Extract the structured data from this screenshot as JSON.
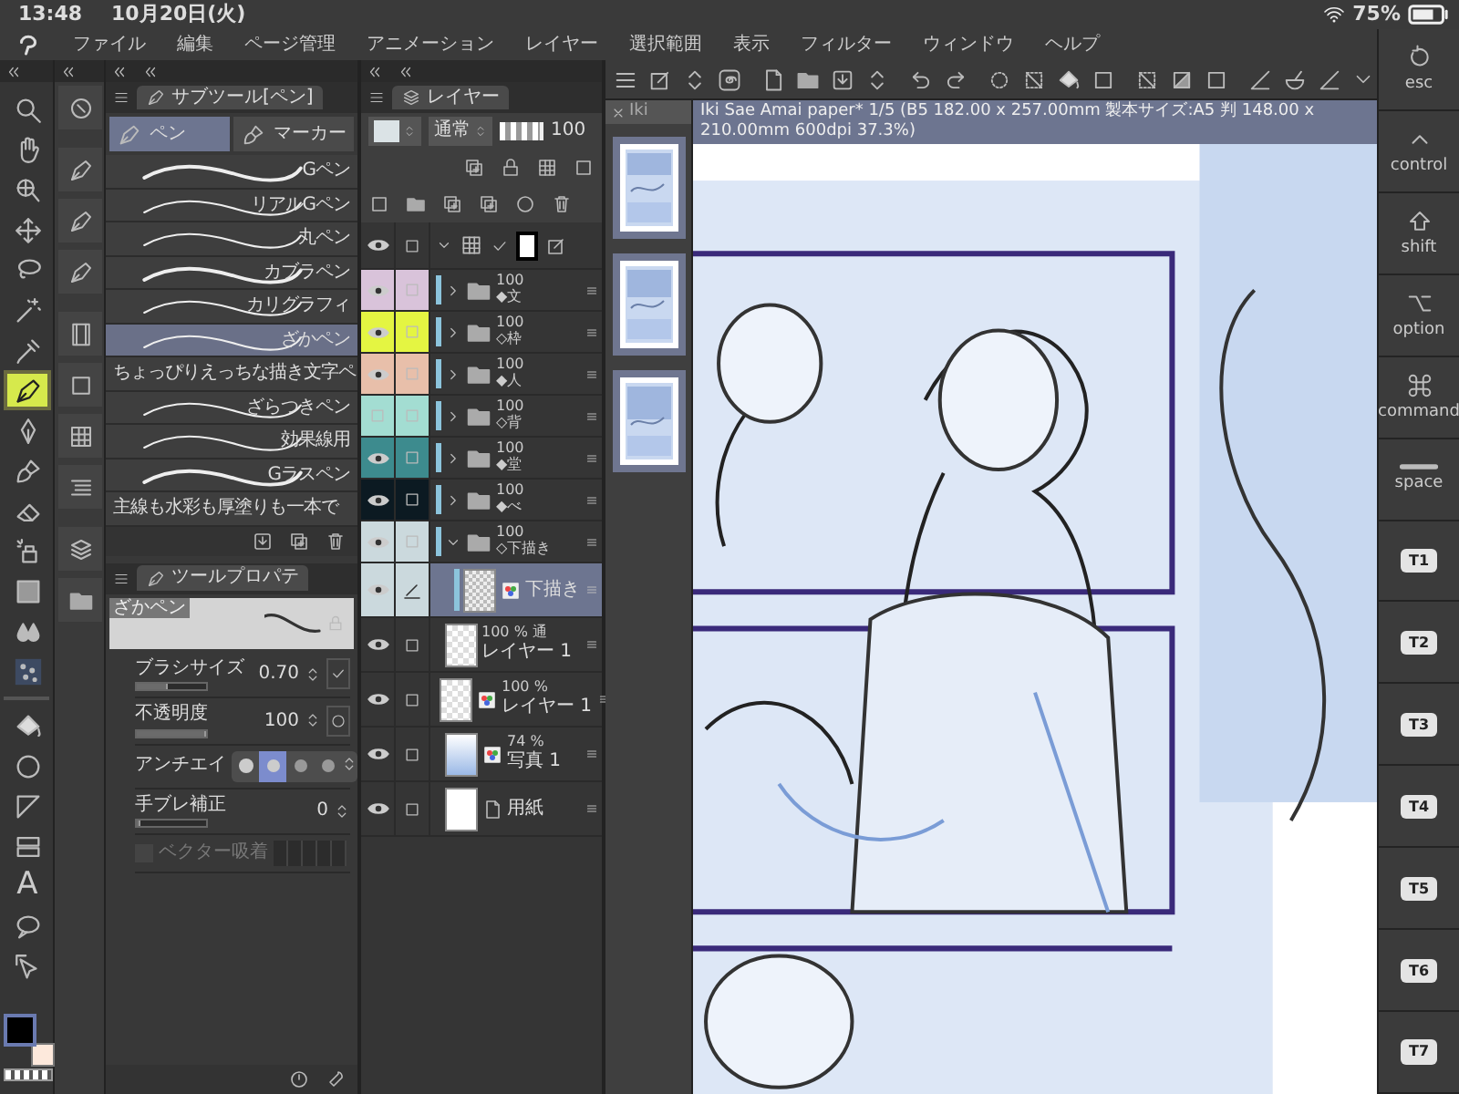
{
  "status_bar": {
    "time": "13:48",
    "date": "10月20日(火)",
    "battery": "75%"
  },
  "menu": [
    "ファイル",
    "編集",
    "ページ管理",
    "アニメーション",
    "レイヤー",
    "選択範囲",
    "表示",
    "フィルター",
    "ウィンドウ",
    "ヘルプ"
  ],
  "tools": [
    {
      "selected": false
    },
    {
      "selected": false
    },
    {
      "selected": false
    },
    {
      "selected": false
    },
    {
      "selected": false
    },
    {
      "selected": false
    },
    {
      "selected": false
    },
    {
      "selected": true
    },
    {
      "selected": false
    },
    {
      "selected": false
    },
    {
      "selected": false
    },
    {
      "selected": false
    },
    {
      "selected": false
    },
    {
      "selected": false
    },
    {
      "selected": false
    },
    {
      "selected": false
    },
    {
      "selected": false
    },
    {
      "selected": false
    },
    {
      "selected": false
    },
    {
      "selected": false,
      "glyph": "A"
    },
    {
      "selected": false
    },
    {
      "selected": false
    }
  ],
  "subtool_panel": {
    "title": "サブツール[ペン]",
    "tabs": [
      {
        "label": "ペン",
        "selected": true
      },
      {
        "label": "マーカー",
        "selected": false
      }
    ],
    "brushes": [
      {
        "kind": "stroke",
        "label": "Gペン",
        "selected": false
      },
      {
        "kind": "stroke",
        "label": "リアルGペン",
        "selected": false
      },
      {
        "kind": "stroke",
        "label": "丸ペン",
        "selected": false
      },
      {
        "kind": "stroke",
        "label": "カブラペン",
        "selected": false
      },
      {
        "kind": "stroke",
        "label": "カリグラフィ",
        "selected": false
      },
      {
        "kind": "stroke",
        "label": "ざかペン",
        "selected": true
      },
      {
        "kind": "text",
        "label": "ちょっぴりえっちな描き文字ペ",
        "selected": false
      },
      {
        "kind": "stroke",
        "label": "ざらつきペン",
        "selected": false
      },
      {
        "kind": "stroke",
        "label": "効果線用",
        "selected": false
      },
      {
        "kind": "stroke",
        "label": "Gラスペン",
        "selected": false
      },
      {
        "kind": "text",
        "label": "主線も水彩も厚塗りも一本で",
        "selected": false
      }
    ]
  },
  "tool_property": {
    "title": "ツールプロパテ",
    "preview_label": "ざかペン",
    "properties": [
      {
        "kind": "slider",
        "label": "ブラシサイズ",
        "value": "0.70",
        "level": 0.45
      },
      {
        "kind": "slider",
        "label": "不透明度",
        "value": "100",
        "level": 1
      },
      {
        "kind": "antialias",
        "label": "アンチエイ",
        "options": [
          {
            "selected": false
          },
          {
            "selected": true
          },
          {
            "selected": false
          },
          {
            "selected": false
          }
        ]
      },
      {
        "kind": "slider",
        "label": "手ブレ補正",
        "value": "0",
        "level": 0
      },
      {
        "kind": "toggle",
        "label": "ベクター吸着",
        "checked": false,
        "disabled": true
      }
    ]
  },
  "layer_panel": {
    "title": "レイヤー",
    "blend_mode": "通常",
    "opacity_slider": {
      "level": 1
    },
    "opacity": "100",
    "layers": [
      {
        "kind": "folder",
        "color": "#d9c3da",
        "visible": true,
        "expanded": false,
        "selected": false,
        "info": "100",
        "name": "◆文"
      },
      {
        "kind": "folder",
        "color": "#e4f542",
        "visible": true,
        "expanded": false,
        "selected": false,
        "info": "100",
        "name": "◇枠"
      },
      {
        "kind": "folder",
        "color": "#e8bfaa",
        "visible": true,
        "expanded": false,
        "selected": false,
        "info": "100",
        "name": "◆人"
      },
      {
        "kind": "folder",
        "color": "#a3ddd2",
        "visible": false,
        "expanded": false,
        "selected": false,
        "info": "100",
        "name": "◇背"
      },
      {
        "kind": "folder",
        "color": "#3d8b8e",
        "visible": true,
        "expanded": false,
        "selected": false,
        "info": "100",
        "name": "◆堂"
      },
      {
        "kind": "folder",
        "color": "#0c1a22",
        "visible": true,
        "expanded": false,
        "selected": false,
        "info": "100",
        "name": "◆べ"
      },
      {
        "kind": "folder",
        "color": "#cbd9dd",
        "visible": true,
        "expanded": true,
        "selected": false,
        "info": "100",
        "name": "◇下描き",
        "children": [
          {
            "kind": "draft",
            "color": "#cbd9dd",
            "visible": true,
            "selected": true,
            "name": "下描き"
          }
        ]
      },
      {
        "kind": "raster",
        "visible": true,
        "selected": false,
        "info": "100 % 通",
        "name": "レイヤー 1"
      },
      {
        "kind": "tone",
        "visible": true,
        "selected": false,
        "info": "100 %",
        "name": "レイヤー 1"
      },
      {
        "visible": true,
        "selected": false,
        "info": "74 %",
        "name": "写真 1"
      },
      {
        "kind": "paper",
        "visible": true,
        "selected": false,
        "name": "用紙"
      }
    ]
  },
  "document": {
    "tab": "Iki",
    "title": "Iki Sae Amai paper* 1/5 (B5 182.00 x 257.00mm 製本サイズ:A5 判 148.00 x 210.00mm 600dpi 37.3%)"
  },
  "keys": [
    {
      "kind": "modifier",
      "label": "esc"
    },
    {
      "kind": "modifier",
      "label": "control"
    },
    {
      "kind": "modifier",
      "label": "shift"
    },
    {
      "kind": "modifier",
      "label": "option"
    },
    {
      "kind": "modifier",
      "label": "command"
    },
    {
      "kind": "modifier",
      "label": "space"
    },
    {
      "kind": "custom",
      "label": "T1"
    },
    {
      "kind": "custom",
      "label": "T2"
    },
    {
      "kind": "custom",
      "label": "T3"
    },
    {
      "kind": "custom",
      "label": "T4"
    },
    {
      "kind": "custom",
      "label": "T5"
    },
    {
      "kind": "custom",
      "label": "T6"
    },
    {
      "kind": "custom",
      "label": "T7"
    }
  ]
}
